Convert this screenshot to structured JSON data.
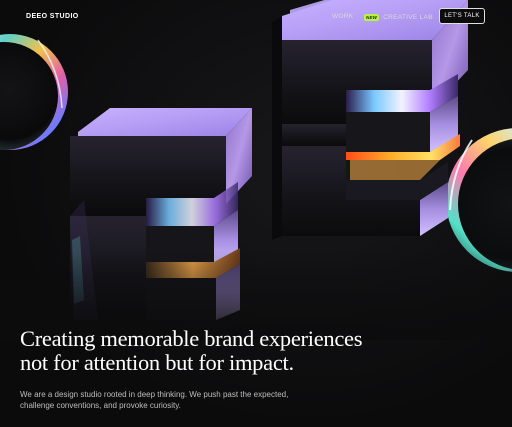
{
  "header": {
    "logo": "DEEO STUDIO",
    "nav": {
      "work_label": "WORK",
      "lab_badge": "NEW",
      "lab_label": "CREATIVE LAB"
    },
    "cta_label": "LET'S TALK"
  },
  "hero": {
    "headline_line1": "Creating memorable brand experiences",
    "headline_line2": "not for attention but for impact.",
    "description_line1": "We are a design studio rooted in deep thinking. We push past the expected,",
    "description_line2": "challenge conventions, and provoke curiosity."
  },
  "colors": {
    "background": "#0c0c0d",
    "badge": "#b6f24a",
    "text": "#ffffff",
    "muted_text": "#bdbdbd"
  }
}
